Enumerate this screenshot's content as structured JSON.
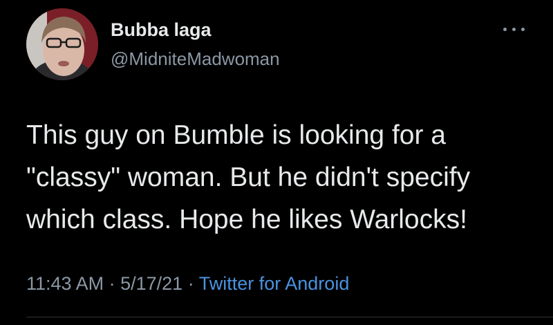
{
  "tweet": {
    "author": {
      "display_name": "Bubba laga",
      "handle": "@MidniteMadwoman",
      "avatar_icon": "profile-photo"
    },
    "more_icon": "more-options-icon",
    "text_lines": [
      "This guy on Bumble is looking for a",
      "\"classy\" woman. But he didn't specify",
      "which class. Hope he likes Warlocks!"
    ],
    "meta": {
      "time": "11:43 AM",
      "separator": "·",
      "date": "5/17/21",
      "source": "Twitter for Android"
    }
  },
  "colors": {
    "background": "#000000",
    "primary_text": "#e7e9ea",
    "secondary_text": "#8b98a5",
    "link": "#4a93e0",
    "divider": "#2f3336"
  }
}
